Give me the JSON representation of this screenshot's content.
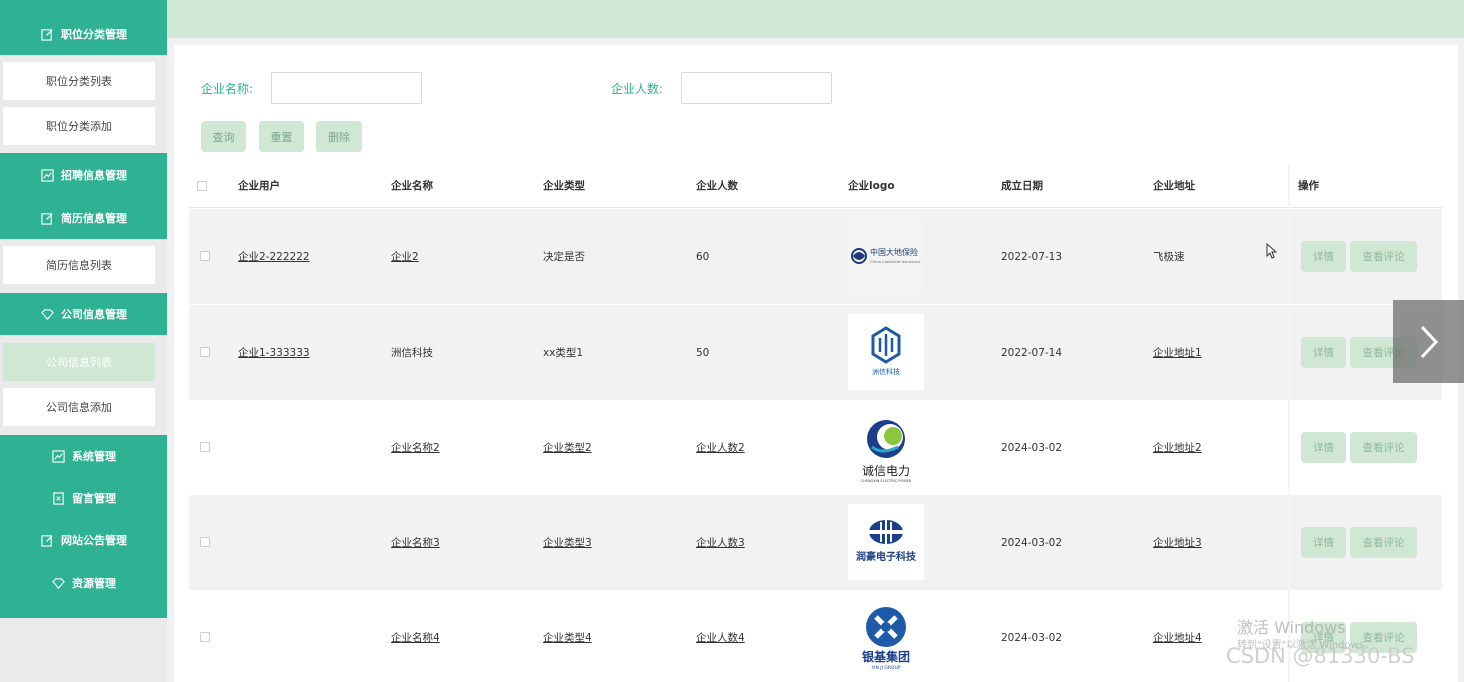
{
  "sidebar": {
    "menus": [
      {
        "label": "职位分类管理",
        "icon": "edit-icon"
      },
      {
        "label": "招聘信息管理",
        "icon": "chart-icon"
      },
      {
        "label": "简历信息管理",
        "icon": "edit-icon"
      },
      {
        "label": "公司信息管理",
        "icon": "diamond-icon"
      },
      {
        "label": "系统管理",
        "icon": "chart-icon"
      },
      {
        "label": "留言管理",
        "icon": "bookmark-icon"
      },
      {
        "label": "网站公告管理",
        "icon": "edit-icon"
      },
      {
        "label": "资源管理",
        "icon": "diamond-icon"
      }
    ],
    "sub_items": [
      {
        "label": "职位分类列表",
        "active": false
      },
      {
        "label": "职位分类添加",
        "active": false
      },
      {
        "label": "简历信息列表",
        "active": false
      },
      {
        "label": "公司信息列表",
        "active": true
      },
      {
        "label": "公司信息添加",
        "active": false
      }
    ]
  },
  "search": {
    "company_name_label": "企业名称:",
    "company_name_value": "",
    "company_size_label": "企业人数:",
    "company_size_value": "",
    "buttons": {
      "query": "查询",
      "reset": "重置",
      "delete": "删除"
    }
  },
  "table": {
    "headers": [
      "企业用户",
      "企业名称",
      "企业类型",
      "企业人数",
      "企业logo",
      "成立日期",
      "企业地址",
      "操作"
    ],
    "rows": [
      {
        "user": "企业2-222222",
        "name": "企业2",
        "type": "决定是否",
        "size": "60",
        "logo": "中国大地保险",
        "date": "2022-07-13",
        "address": "飞极速"
      },
      {
        "user": "企业1-333333",
        "name": "洲信科技",
        "type": "xx类型1",
        "size": "50",
        "logo": "洲信科技",
        "date": "2022-07-14",
        "address": "企业地址1"
      },
      {
        "user": "",
        "name": "企业名称2",
        "type": "企业类型2",
        "size": "企业人数2",
        "logo": "诚信电力",
        "date": "2024-03-02",
        "address": "企业地址2"
      },
      {
        "user": "",
        "name": "企业名称3",
        "type": "企业类型3",
        "size": "企业人数3",
        "logo": "润豪电子科技",
        "date": "2024-03-02",
        "address": "企业地址3"
      },
      {
        "user": "",
        "name": "企业名称4",
        "type": "企业类型4",
        "size": "企业人数4",
        "logo": "银基集团",
        "date": "2024-03-02",
        "address": "企业地址4"
      }
    ],
    "row_actions": {
      "detail": "详情",
      "comments": "查看评论"
    }
  },
  "logos": {
    "dadi_cn": "中国大地保险",
    "dadi_en": "China Continent Insurance",
    "chengxin_cn": "诚信电力",
    "chengxin_en": "CHENGXIN ELECTRIC POWER",
    "runhao_cn": "润豪电子科技",
    "yinji_cn": "银基集团",
    "yinji_en": "YIN JI GROUP"
  },
  "watermarks": {
    "windows_line1": "激活 Windows",
    "windows_line2": "转到\"设置\"以激活 Windows。",
    "csdn": "CSDN @81330-BS"
  },
  "colors": {
    "primary": "#2eb293",
    "light": "#cfe7d3"
  }
}
